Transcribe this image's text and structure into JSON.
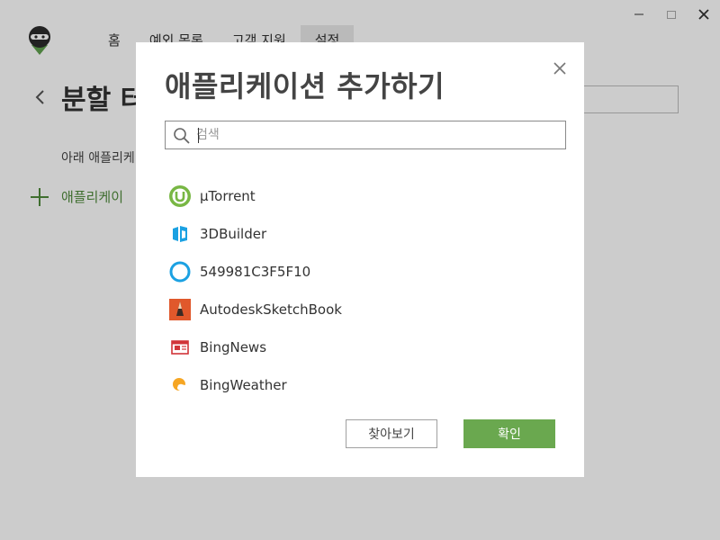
{
  "nav": {
    "items": [
      {
        "label": "홈"
      },
      {
        "label": "예외 목록"
      },
      {
        "label": "고객 지원"
      },
      {
        "label": "설정",
        "active": true
      }
    ]
  },
  "page": {
    "title": "분할 터",
    "description": "아래 애플리케",
    "add_app_label": "애플리케이"
  },
  "dialog": {
    "title": "애플리케이션 추가하기",
    "search": {
      "placeholder": "검색",
      "value": ""
    },
    "apps": [
      {
        "name": "µTorrent",
        "icon": "utorrent-icon"
      },
      {
        "name": "3DBuilder",
        "icon": "3dbuilder-icon"
      },
      {
        "name": "549981C3F5F10",
        "icon": "cortana-ring-icon"
      },
      {
        "name": "AutodeskSketchBook",
        "icon": "sketchbook-icon"
      },
      {
        "name": "BingNews",
        "icon": "news-icon"
      },
      {
        "name": "BingWeather",
        "icon": "weather-icon"
      }
    ],
    "buttons": {
      "browse": "찾아보기",
      "ok": "확인"
    }
  },
  "colors": {
    "accent_green": "#6aa84f",
    "overlay": "rgba(0,0,0,0.2)"
  }
}
